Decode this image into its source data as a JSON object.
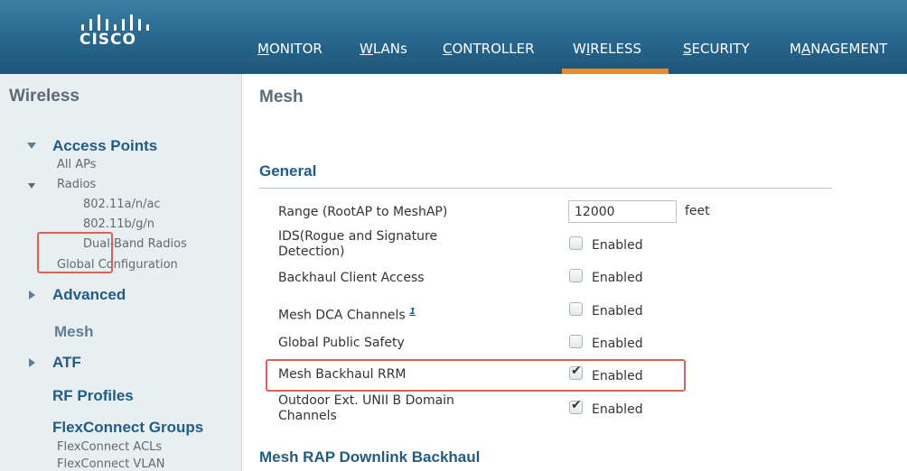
{
  "brand": {
    "logo_text": "CISCO"
  },
  "nav": {
    "items": [
      {
        "label": "MONITOR",
        "ul": "M",
        "rest": "ONITOR"
      },
      {
        "label": "WLANs",
        "ul": "W",
        "rest": "LANs"
      },
      {
        "label": "CONTROLLER",
        "ul": "C",
        "rest": "ONTROLLER"
      },
      {
        "label": "WIRELESS",
        "pre": "W",
        "ul": "I",
        "rest": "RELESS"
      },
      {
        "label": "SECURITY",
        "ul": "S",
        "rest": "ECURITY"
      },
      {
        "label": "MANAGEMENT",
        "pre": "M",
        "ul": "A",
        "rest": "NAGEMENT"
      }
    ],
    "active": "WIRELESS",
    "active_color": "#f08a24"
  },
  "sidebar": {
    "title": "Wireless",
    "access_points": {
      "label": "Access Points",
      "all_aps": "All APs",
      "radios": "Radios",
      "radio_items": [
        "802.11a/n/ac",
        "802.11b/g/n",
        "Dual-Band Radios"
      ],
      "global_config": "Global Configuration"
    },
    "advanced": "Advanced",
    "mesh": "Mesh",
    "atf": "ATF",
    "rf_profiles": "RF Profiles",
    "flexconnect": {
      "label": "FlexConnect Groups",
      "items": [
        "FlexConnect ACLs",
        "FlexConnect VLAN"
      ]
    }
  },
  "main": {
    "title": "Mesh",
    "general_title": "General",
    "range": {
      "label": "Range (RootAP to MeshAP)",
      "value": "12000",
      "unit": "feet"
    },
    "settings": [
      {
        "label_line1": "IDS(Rogue and Signature",
        "label_line2": "Detection)",
        "checked": false,
        "option": "Enabled"
      },
      {
        "label_line1": "Backhaul Client Access",
        "label_line2": "",
        "checked": false,
        "option": "Enabled"
      },
      {
        "label_line1": "Mesh DCA Channels",
        "label_line2": "",
        "footnote": "1",
        "checked": false,
        "option": "Enabled"
      },
      {
        "label_line1": "Global Public Safety",
        "label_line2": "",
        "checked": false,
        "option": "Enabled"
      },
      {
        "label_line1": "Mesh Backhaul RRM",
        "label_line2": "",
        "checked": true,
        "option": "Enabled"
      },
      {
        "label_line1": "Outdoor Ext. UNII B Domain",
        "label_line2": "Channels",
        "checked": true,
        "option": "Enabled"
      }
    ],
    "downlink_title": "Mesh RAP Downlink Backhaul"
  },
  "icons": {
    "expanded": "triangle-down-icon",
    "collapsed": "triangle-right-icon",
    "checkmark": "checkmark-icon"
  },
  "colors": {
    "header": "#2a6a90",
    "sidebar_bg": "#e9eef1",
    "link": "#1c5e8a",
    "highlight_box": "#d6625a"
  }
}
